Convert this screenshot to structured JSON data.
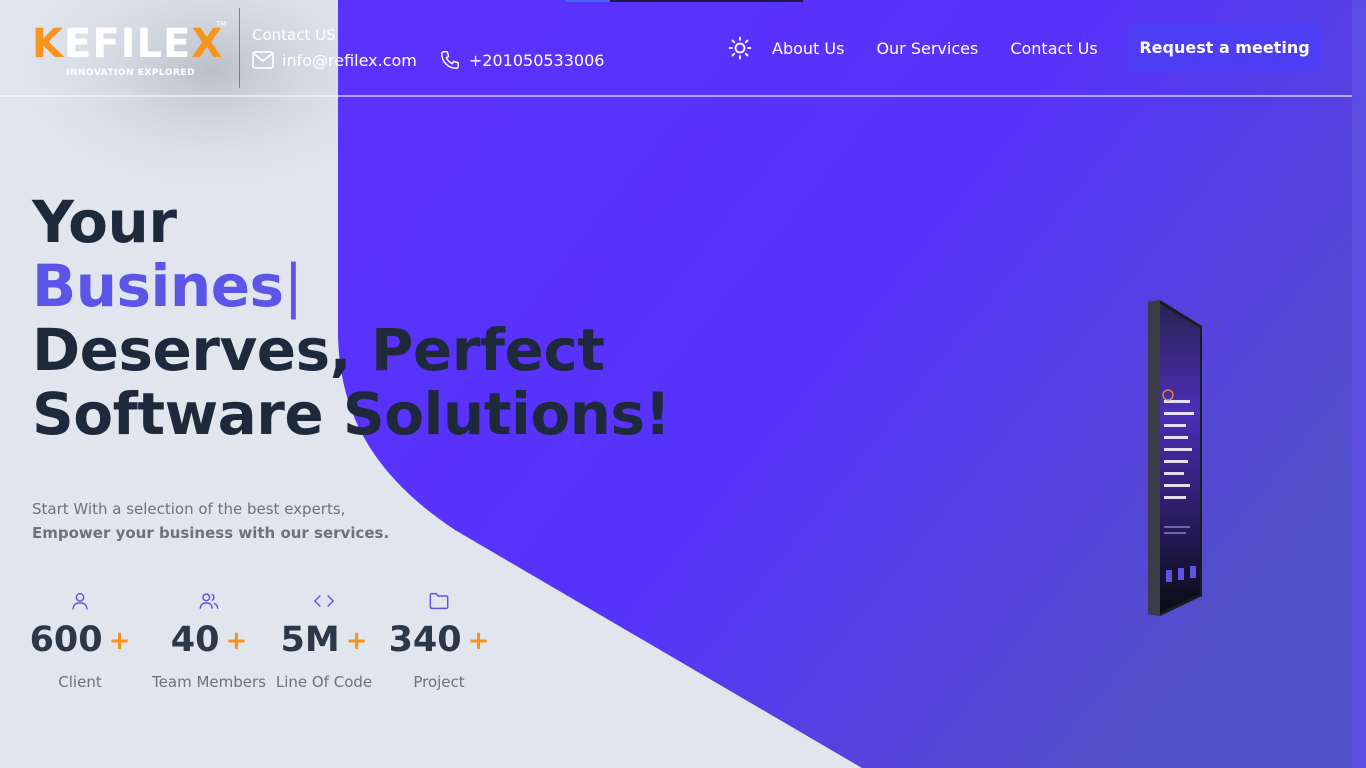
{
  "brand": {
    "name_k": "K",
    "name_rest": "EFILE",
    "name_x": "X",
    "tagline": "INNOVATION EXPLORED",
    "tm": "TM",
    "accent": "#f7941d",
    "primary": "#5b36ff"
  },
  "contact": {
    "title": "Contact US",
    "email": "info@refilex.com",
    "phone": "+201050533006"
  },
  "nav": {
    "theme_toggle_icon": "sun-icon",
    "items": [
      {
        "label": "About Us"
      },
      {
        "label": "Our Services"
      },
      {
        "label": "Contact Us"
      }
    ],
    "cta": "Request a meeting"
  },
  "hero": {
    "line1": "Your",
    "typed": "Busines",
    "caret": "|",
    "line3a": "Deserves, ",
    "line3b": "Perfect",
    "line4": "Software Solutions!",
    "sub1": "Start With a selection of the best experts,",
    "sub2": "Empower your business with our services."
  },
  "stats": [
    {
      "icon": "user-icon",
      "value": "600",
      "plus": "+",
      "label": "Client"
    },
    {
      "icon": "users-icon",
      "value": "40",
      "plus": "+",
      "label": "Team Members"
    },
    {
      "icon": "code-icon",
      "value": "5M",
      "plus": "+",
      "label": "Line Of Code"
    },
    {
      "icon": "folder-icon",
      "value": "340",
      "plus": "+",
      "label": "Project"
    }
  ]
}
